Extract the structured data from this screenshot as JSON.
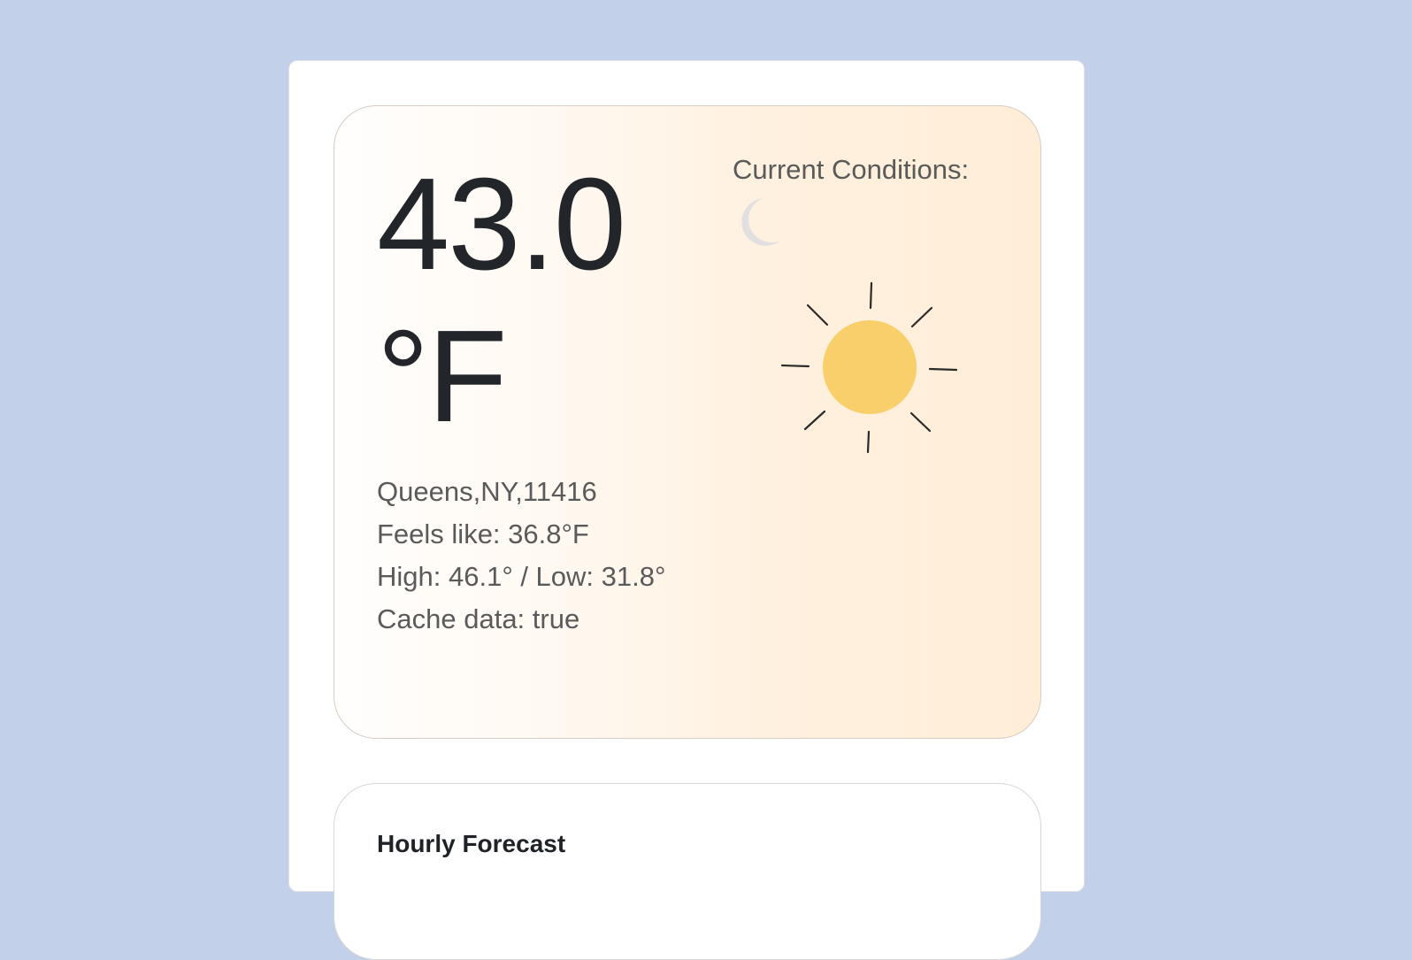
{
  "current": {
    "temperature": "43.0 °F",
    "location": "Queens,NY,11416",
    "feels_like": "Feels like: 36.8°F",
    "high_low": "High: 46.1° / Low: 31.8°",
    "cache": "Cache data: true",
    "conditions_label": "Current Conditions:",
    "icons": [
      "moon-icon",
      "sun-icon"
    ]
  },
  "forecast": {
    "title": "Hourly Forecast"
  },
  "colors": {
    "background": "#c2d0ea",
    "sun": "#f8cf6a",
    "moon": "#e0e0e0",
    "text": "#22252a"
  }
}
